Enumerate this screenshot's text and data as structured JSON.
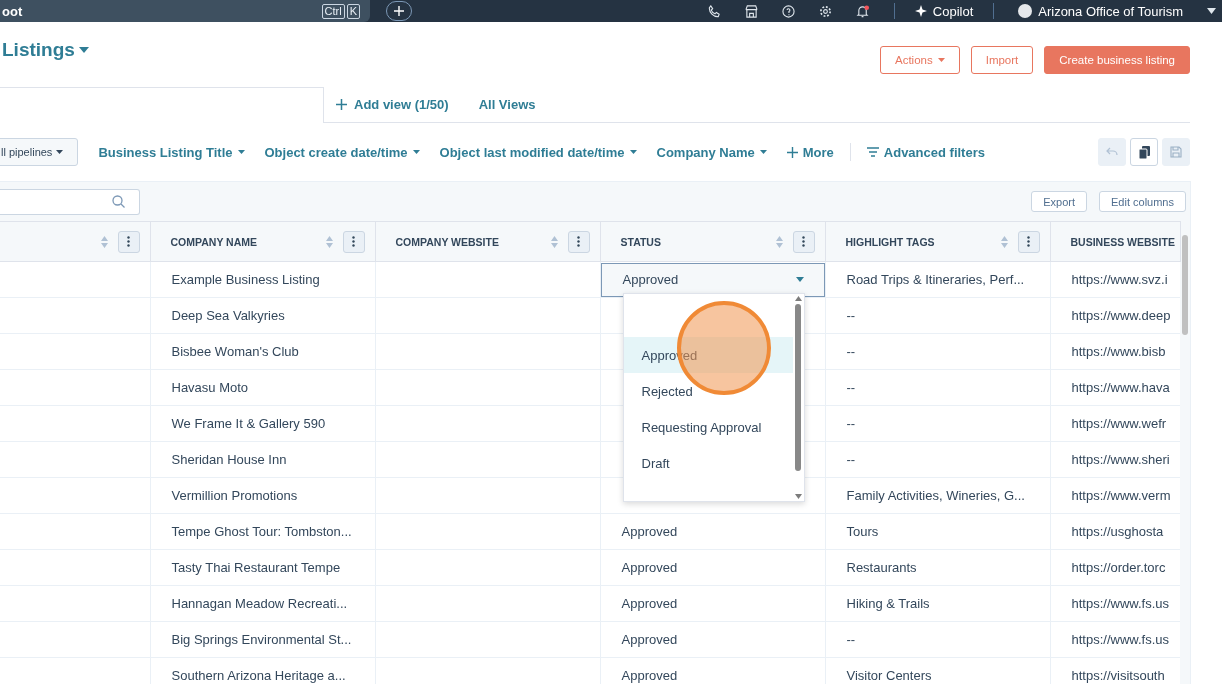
{
  "top_bar": {
    "search_text": "oot",
    "shortcut_keys": [
      "Ctrl",
      "K"
    ],
    "copilot": "Copilot",
    "account": "Arizona Office of Tourism"
  },
  "header": {
    "title": "Listings",
    "buttons": [
      {
        "label": "Actions",
        "kind": "menu"
      },
      {
        "label": "Import",
        "kind": "outline"
      },
      {
        "label": "Create business listing",
        "kind": "primary"
      }
    ]
  },
  "views": {
    "add_view": "Add view (1/50)",
    "all_views": "All Views"
  },
  "filters": [
    {
      "label": "ll pipelines",
      "kind": "pill"
    },
    {
      "label": "Business Listing Title",
      "kind": "dropdown"
    },
    {
      "label": "Object create date/time",
      "kind": "dropdown"
    },
    {
      "label": "Object last modified date/time",
      "kind": "dropdown"
    },
    {
      "label": "Company Name",
      "kind": "dropdown"
    },
    {
      "label": "More",
      "kind": "add"
    },
    {
      "label": "Advanced filters",
      "kind": "advanced"
    }
  ],
  "view_actions": [
    {
      "kind": "undo",
      "disabled": true
    },
    {
      "kind": "copy",
      "disabled": false
    },
    {
      "kind": "save",
      "disabled": true
    }
  ],
  "table_actions": [
    "Export",
    "Edit columns"
  ],
  "table": {
    "columns": [
      {
        "kind": "sortable"
      },
      {
        "label": "COMPANY NAME",
        "kind": "sortable"
      },
      {
        "label": "COMPANY WEBSITE",
        "kind": "sortable"
      },
      {
        "label": "STATUS",
        "kind": "sortable"
      },
      {
        "label": "HIGHLIGHT TAGS",
        "kind": "sortable"
      },
      {
        "label": "BUSINESS WEBSITE",
        "kind": "plain"
      }
    ],
    "rows": [
      {
        "company": "Example Business Listing",
        "status": "Approved",
        "editing": true,
        "tags": "Road Trips & Itineraries, Perf...",
        "website": "https://www.svz.i"
      },
      {
        "company": "Deep Sea Valkyries",
        "editing": false,
        "tags": "--",
        "website": "https://www.deep"
      },
      {
        "company": "Bisbee Woman's Club",
        "editing": false,
        "tags": "--",
        "website": "https://www.bisb"
      },
      {
        "company": "Havasu Moto",
        "editing": false,
        "tags": "--",
        "website": "https://www.hava"
      },
      {
        "company": "We Frame It & Gallery 590",
        "editing": false,
        "tags": "--",
        "website": "https://www.wefr"
      },
      {
        "company": "Sheridan House Inn",
        "editing": false,
        "tags": "--",
        "website": "https://www.sheri"
      },
      {
        "company": "Vermillion Promotions",
        "editing": false,
        "tags": "Family Activities, Wineries, G...",
        "website": "https://www.verm"
      },
      {
        "company": "Tempe Ghost Tour: Tombston...",
        "status": "Approved",
        "editing": false,
        "tags": "Tours",
        "website": "https://usghosta"
      },
      {
        "company": "Tasty Thai Restaurant Tempe",
        "status": "Approved",
        "editing": false,
        "tags": "Restaurants",
        "website": "https://order.torc"
      },
      {
        "company": "Hannagan Meadow Recreati...",
        "status": "Approved",
        "editing": false,
        "tags": "Hiking & Trails",
        "website": "https://www.fs.us"
      },
      {
        "company": "Big Springs Environmental St...",
        "status": "Approved",
        "editing": false,
        "tags": "--",
        "website": "https://www.fs.us"
      },
      {
        "company": "Southern Arizona Heritage a...",
        "status": "Approved",
        "editing": false,
        "tags": "Visitor Centers",
        "website": "https://visitsouth"
      }
    ]
  },
  "status_menu": {
    "options": [
      {
        "label": "Approved",
        "selected": true
      },
      {
        "label": "Rejected",
        "selected": false
      },
      {
        "label": "Requesting Approval",
        "selected": false
      },
      {
        "label": "Draft",
        "selected": false
      }
    ]
  }
}
